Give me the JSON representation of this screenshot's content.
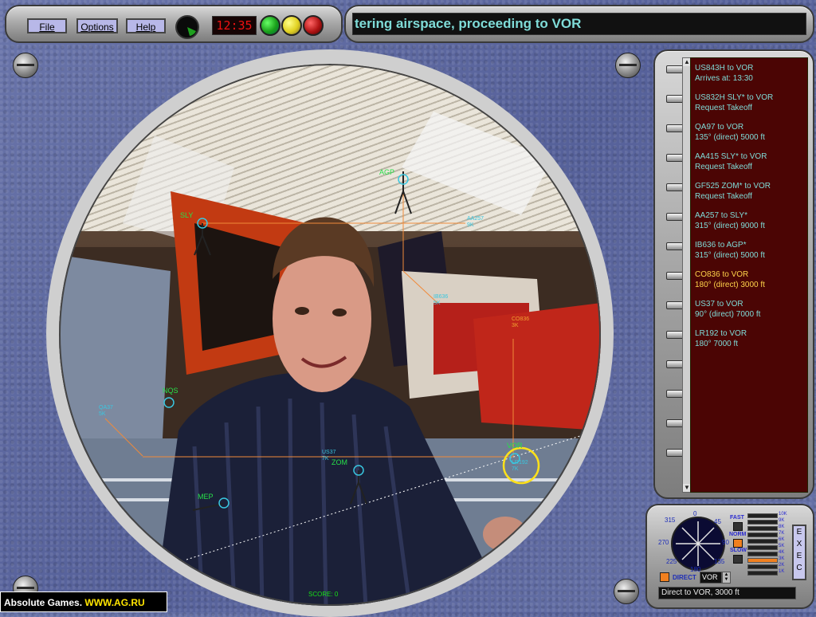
{
  "menu": {
    "file": "File",
    "options": "Options",
    "help": "Help"
  },
  "clock": "12:35",
  "lights": {
    "green": "#1aa01a",
    "yellow": "#e0d020",
    "red": "#b01414"
  },
  "message": "tering airspace, proceeding to VOR",
  "radar": {
    "score": "SCORE: 0",
    "waypoints": {
      "agp": "AGP",
      "sly": "SLY",
      "nqs": "NQS",
      "zom": "ZOM",
      "mep": "MEP",
      "vor": "VOR"
    },
    "aircraft": {
      "aa257": {
        "id": "AA257",
        "alt": "9K"
      },
      "ib636": {
        "id": "IB636",
        "alt": "5K"
      },
      "co836": {
        "id": "CO836",
        "alt": "3K"
      },
      "qa37": {
        "id": "QA37",
        "alt": "5K"
      },
      "us37": {
        "id": "US37",
        "alt": "7K"
      },
      "lr192": {
        "id": "LR192",
        "alt": "7K"
      }
    }
  },
  "strips": [
    {
      "line1": "US843H  to  VOR",
      "line2": "Arrives at: 13:30"
    },
    {
      "line1": "US832H  SLY* to VOR",
      "line2": "Request Takeoff"
    },
    {
      "line1": "QA97  to  VOR",
      "line2": "135°  (direct)   5000 ft"
    },
    {
      "line1": "AA415  SLY* to VOR",
      "line2": "Request Takeoff"
    },
    {
      "line1": "GF525  ZOM* to VOR",
      "line2": "Request Takeoff"
    },
    {
      "line1": "AA257  to  SLY*",
      "line2": "315°  (direct)   9000 ft"
    },
    {
      "line1": "IB636  to  AGP*",
      "line2": "315°  (direct)   5000 ft"
    },
    {
      "line1": "CO836  to  VOR",
      "line2": "180°  (direct)   3000 ft"
    },
    {
      "line1": "US37  to  VOR",
      "line2": "90°  (direct)   7000 ft"
    },
    {
      "line1": "LR192  to  VOR",
      "line2": "180°    7000 ft"
    }
  ],
  "controls": {
    "compass": {
      "n": "0",
      "ne": "45",
      "e": "90",
      "se": "135",
      "s": "180",
      "sw": "225",
      "w": "270",
      "nw": "315"
    },
    "speed": {
      "fast": "FAST",
      "norm": "NORM",
      "slow": "SLOW"
    },
    "altitudes": [
      "10K",
      "9K",
      "8K",
      "7K",
      "6K",
      "5K",
      "4K",
      "3K",
      "2K",
      "1K"
    ],
    "exec": "EXEC",
    "direct": "DIRECT",
    "destination": "VOR",
    "command": "Direct to VOR, 3000 ft"
  },
  "watermark": {
    "name": "Absolute Games.",
    "url": "WWW.AG.RU"
  }
}
